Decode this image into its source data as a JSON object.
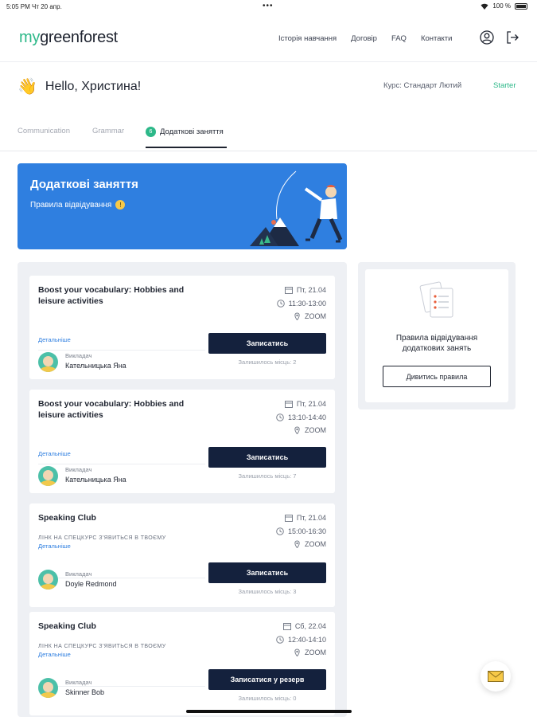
{
  "status_bar": {
    "time_date": "5:05 PM   Чт 20 апр.",
    "battery": "100 %",
    "dots": "•••"
  },
  "logo": {
    "prefix": "my",
    "rest": "greenforest"
  },
  "nav": [
    "Історія навчання",
    "Договір",
    "FAQ",
    "Контакти"
  ],
  "greeting": {
    "emoji": "👋",
    "text": "Hello, Христина!"
  },
  "course": {
    "label": "Курс: Стандарт Лютий",
    "level": "Starter"
  },
  "tabs": [
    {
      "label": "Communication"
    },
    {
      "label": "Grammar"
    },
    {
      "label": "Додаткові заняття",
      "badge": "6"
    }
  ],
  "banner": {
    "title": "Додаткові заняття",
    "rules_link": "Правила відвідування",
    "info_icon": "!"
  },
  "lessons": [
    {
      "name": "Boost your vocabulary: Hobbies and leisure activities",
      "note": "",
      "details": "Детальніше",
      "teacher_label": "Викладач",
      "teacher": "Кательницька Яна",
      "date": "Пт, 21.04",
      "time": "11:30-13:00",
      "location": "ZOOM",
      "cta": "Записатись",
      "seats": "Залишилось місць: 2"
    },
    {
      "name": "Boost your vocabulary: Hobbies and leisure activities",
      "note": "",
      "details": "Детальніше",
      "teacher_label": "Викладач",
      "teacher": "Кательницька Яна",
      "date": "Пт, 21.04",
      "time": "13:10-14:40",
      "location": "ZOOM",
      "cta": "Записатись",
      "seats": "Залишилось місць: 7"
    },
    {
      "name": "Speaking Club",
      "note": "ЛІНК НА СПЕЦКУРС З'ЯВИТЬСЯ В ТВОЄМУ",
      "details": "Детальніше",
      "teacher_label": "Викладач",
      "teacher": "Doyle Redmond",
      "date": "Пт, 21.04",
      "time": "15:00-16:30",
      "location": "ZOOM",
      "cta": "Записатись",
      "seats": "Залишилось місць: 3"
    },
    {
      "name": "Speaking Club",
      "note": "ЛІНК НА СПЕЦКУРС З'ЯВИТЬСЯ В ТВОЄМУ",
      "details": "Детальніше",
      "teacher_label": "Викладач",
      "teacher": "Skinner Bob",
      "date": "Сб, 22.04",
      "time": "12:40-14:10",
      "location": "ZOOM",
      "cta": "Записатися у резерв",
      "seats": "Залишилось місць: 0"
    }
  ],
  "rules_card": {
    "caption_line1": "Правила відвідування",
    "caption_line2": "додаткових занять",
    "button": "Дивитись правила"
  },
  "colors": {
    "brand_green": "#2db889",
    "banner_blue": "#2f7fe0",
    "cta_navy": "#14213d"
  }
}
